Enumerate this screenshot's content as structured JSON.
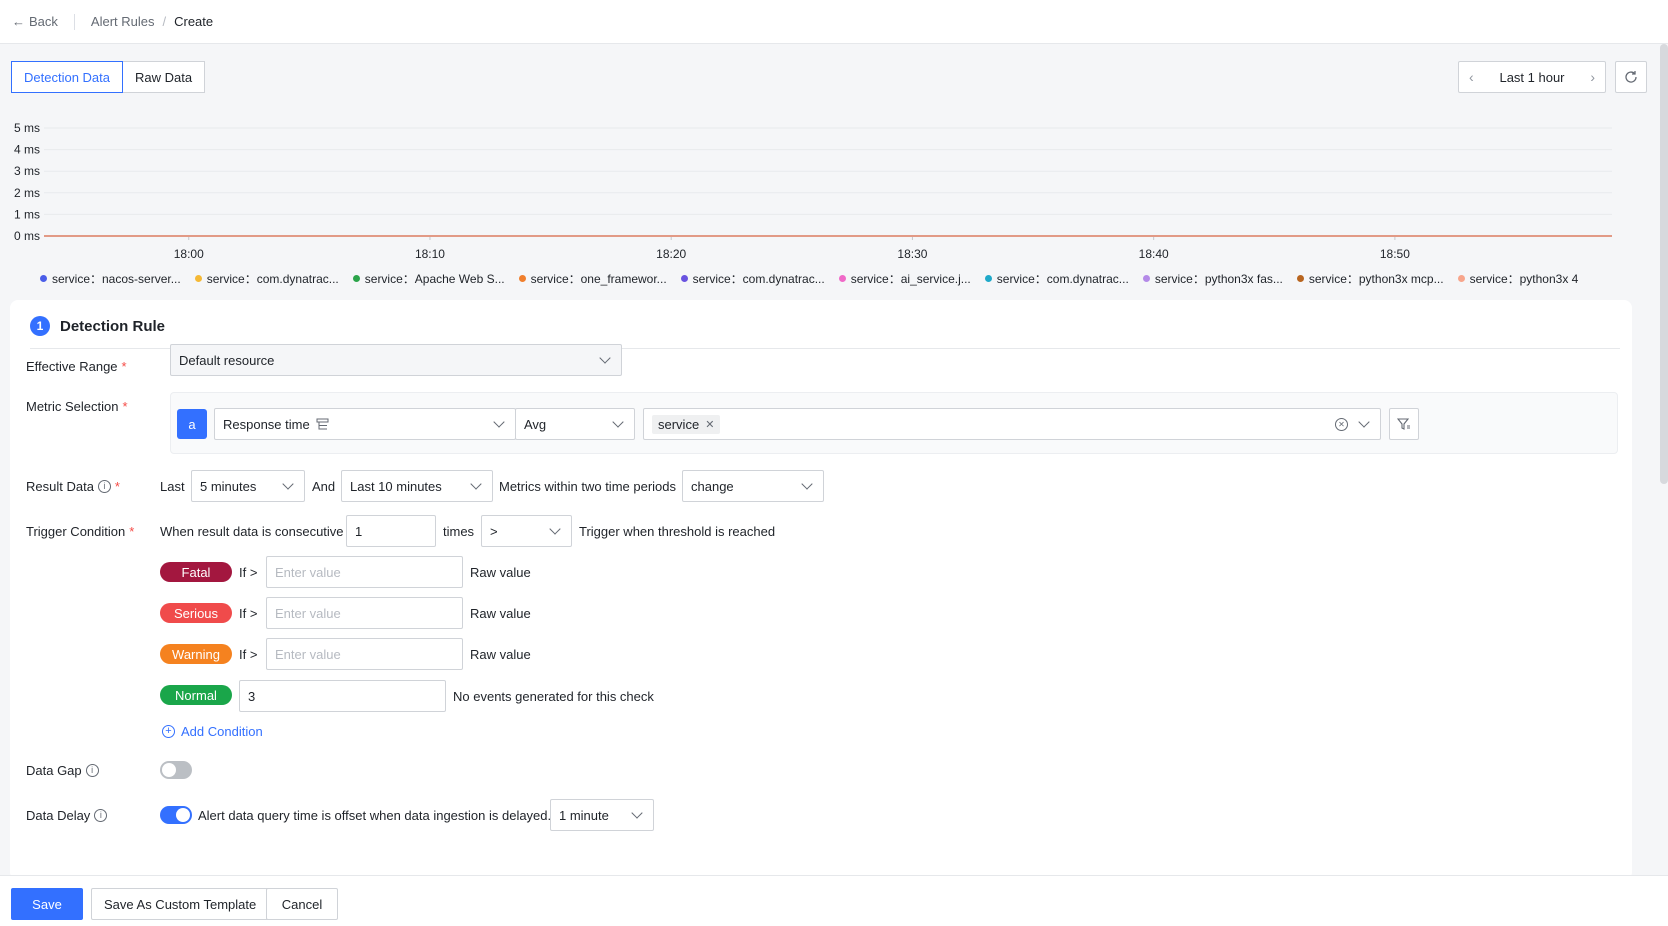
{
  "nav": {
    "back": "Back",
    "crumb_parent": "Alert Rules",
    "crumb_current": "Create",
    "crumb_sep": "/"
  },
  "tabs": [
    {
      "label": "Detection Data",
      "active": true
    },
    {
      "label": "Raw Data",
      "active": false
    }
  ],
  "time_range": {
    "label": "Last 1 hour"
  },
  "chart_data": {
    "type": "line",
    "y_ticks": [
      "5 ms",
      "4 ms",
      "3 ms",
      "2 ms",
      "1 ms",
      "0 ms"
    ],
    "x_ticks": [
      "18:00",
      "18:10",
      "18:20",
      "18:30",
      "18:40",
      "18:50"
    ],
    "ylim": [
      0,
      5
    ],
    "series": [
      {
        "name": "service：nacos-server...",
        "color": "#4a5de8",
        "values": [
          0,
          0,
          0,
          0,
          0,
          0,
          0
        ]
      },
      {
        "name": "service：com.dynatrac...",
        "color": "#f5b936",
        "values": [
          0,
          0,
          0,
          0,
          0,
          0,
          0
        ]
      },
      {
        "name": "service：Apache Web S...",
        "color": "#2ba44a",
        "values": [
          0,
          0,
          0,
          0,
          0,
          0,
          0
        ]
      },
      {
        "name": "service：one_framewor...",
        "color": "#f07f2d",
        "values": [
          0,
          0,
          0,
          0,
          0,
          0,
          0
        ]
      },
      {
        "name": "service：com.dynatrac...",
        "color": "#6953e0",
        "values": [
          0,
          0,
          0,
          0,
          0,
          0,
          0
        ]
      },
      {
        "name": "service：ai_service.j...",
        "color": "#f06ac8",
        "values": [
          0,
          0,
          0,
          0,
          0,
          0,
          0
        ]
      },
      {
        "name": "service：com.dynatrac...",
        "color": "#1fa9c9",
        "values": [
          0,
          0,
          0,
          0,
          0,
          0,
          0
        ]
      },
      {
        "name": "service：python3x fas...",
        "color": "#b48ae8",
        "values": [
          0,
          0,
          0,
          0,
          0,
          0,
          0
        ]
      },
      {
        "name": "service：python3x mcp...",
        "color": "#b8651f",
        "values": [
          0,
          0,
          0,
          0,
          0,
          0,
          0
        ]
      },
      {
        "name": "service：python3x 4",
        "color": "#f7a58b",
        "values": [
          0,
          0,
          0,
          0,
          0,
          0,
          0
        ]
      }
    ]
  },
  "rule": {
    "step": "1",
    "title": "Detection Rule",
    "effective_range": {
      "label": "Effective Range",
      "value": "Default resource"
    },
    "metric_selection": {
      "label": "Metric Selection",
      "badge": "a",
      "metric": "Response time",
      "agg": "Avg",
      "tag": "service"
    },
    "result_data": {
      "label": "Result Data",
      "last": "Last",
      "period1": "5 minutes",
      "and": "And",
      "period2": "Last 10 minutes",
      "desc": "Metrics within two time periods",
      "mode": "change"
    },
    "trigger": {
      "label": "Trigger Condition",
      "prefix": "When result data is consecutive",
      "count": "1",
      "times": "times",
      "op": ">",
      "suffix": "Trigger when threshold is reached"
    },
    "levels": [
      {
        "name": "Fatal",
        "color": "#a3173f",
        "if": "If >",
        "placeholder": "Enter value",
        "unit": "Raw value"
      },
      {
        "name": "Serious",
        "color": "#f04b4b",
        "if": "If >",
        "placeholder": "Enter value",
        "unit": "Raw value"
      },
      {
        "name": "Warning",
        "color": "#f5821f",
        "if": "If >",
        "placeholder": "Enter value",
        "unit": "Raw value"
      }
    ],
    "normal": {
      "name": "Normal",
      "color": "#1aa64a",
      "value": "3",
      "desc": "No events generated for this check"
    },
    "add_condition": "Add Condition",
    "data_gap": {
      "label": "Data Gap",
      "on": false
    },
    "data_delay": {
      "label": "Data Delay",
      "on": true,
      "desc": "Alert data query time is offset when data ingestion is delayed.",
      "value": "1 minute"
    }
  },
  "footer": {
    "save": "Save",
    "save_template": "Save As Custom Template",
    "cancel": "Cancel"
  }
}
